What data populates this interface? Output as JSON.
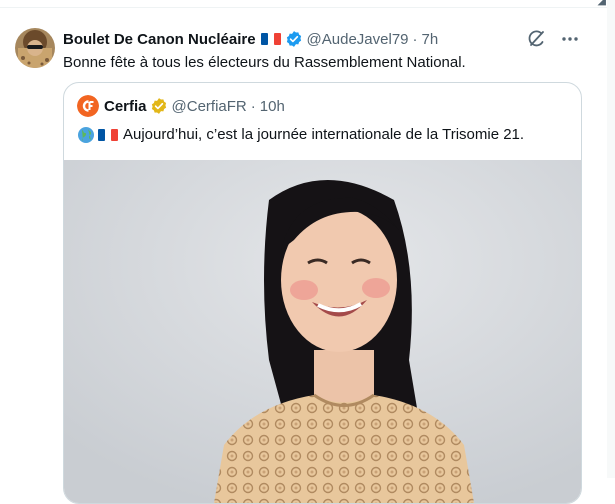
{
  "tweet": {
    "author_name": "Boulet De Canon Nucléaire",
    "handle": "@AudeJavel79",
    "separator": "·",
    "time": "7h",
    "text": "Bonne fête à tous les électeurs du Rassemblement National.",
    "icons": [
      "france-flag-icon",
      "verified-badge-icon",
      "grok-icon",
      "more-icon"
    ]
  },
  "quote": {
    "author_name": "Cerfia",
    "handle": "@CerfiaFR",
    "separator": "·",
    "time": "10h",
    "text": "Aujourd’hui, c’est la journée internationale de la Trisomie 21.",
    "icons": [
      "globe-icon",
      "france-flag-icon",
      "gold-verified-badge-icon"
    ]
  },
  "colors": {
    "text_primary": "#0f1419",
    "text_secondary": "#536471",
    "verified_blue": "#1d9bf0",
    "verified_gold": "#e2b719",
    "border": "#cfd9de",
    "cerfia_orange": "#f26522"
  }
}
